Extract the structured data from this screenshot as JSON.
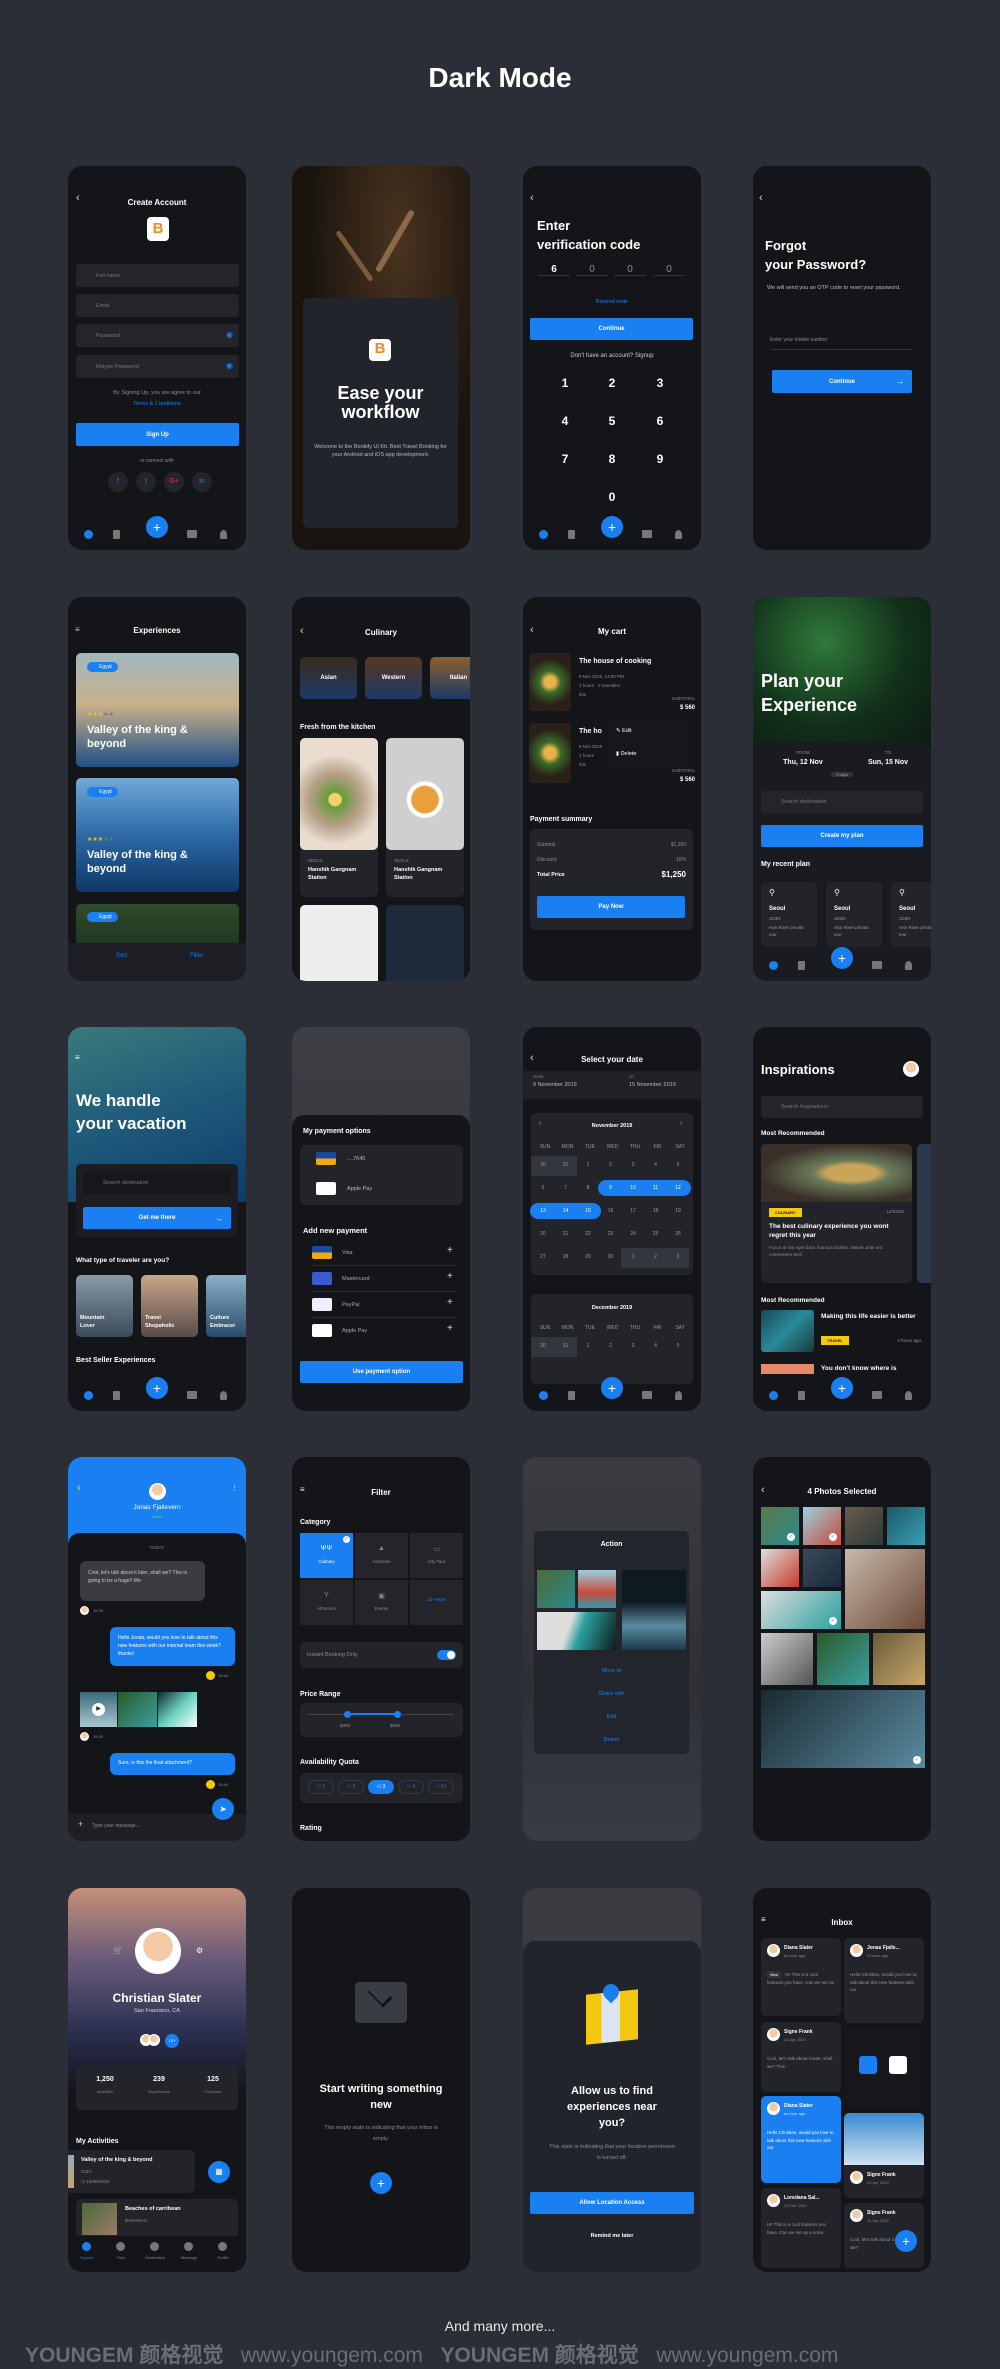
{
  "page": {
    "title": "Dark Mode",
    "footer": "And many more...",
    "watermark": [
      "YOUNGEM 颜格视觉",
      "www.youngem.com",
      "YOUNGEM 颜格视觉",
      "www.youngem.com"
    ]
  },
  "colors": {
    "accent": "#1a7ff0",
    "background": "#2b2e36",
    "phone": "#141518",
    "card": "#22242a",
    "logo": "#f08a24",
    "tag": "#f2c811"
  },
  "brand": {
    "logo_letter": "B"
  },
  "create_account": {
    "title": "Create Account",
    "fields": [
      "Full name",
      "Email",
      "Password",
      "Retype Password"
    ],
    "agree": "By Signing Up, you are agree to our",
    "terms": "Terms & Conditions",
    "signup": "Sign Up",
    "connect": "or connect with",
    "socials": [
      "f",
      "t",
      "G+",
      "in"
    ]
  },
  "onboarding": {
    "title": "Ease your workflow",
    "body": "Welcome to the Bookify UI Kit. Best Travel Booking for your Andriod and iOS app development."
  },
  "verify": {
    "title1": "Enter",
    "title2": "verification code",
    "digits": [
      "6",
      "0",
      "0",
      "0"
    ],
    "resend": "Resend code",
    "continue": "Continue",
    "signup": "Don't have an account? Signup",
    "keys": [
      "1",
      "2",
      "3",
      "4",
      "5",
      "6",
      "7",
      "8",
      "9",
      "0"
    ]
  },
  "forgot": {
    "title1": "Forgot",
    "title2": "your Password?",
    "body": "We will send you an OTP code to reset your password.",
    "placeholder": "Enter your mobile number",
    "continue": "Continue"
  },
  "experiences": {
    "title": "Experiences",
    "cards": [
      {
        "tag": "Egypt",
        "title": "Valley of the king & beyond",
        "rating": 3
      },
      {
        "tag": "Egypt",
        "title": "Valley of the king & beyond",
        "rating": 3
      },
      {
        "tag": "Egypt"
      }
    ],
    "sort": "Sort",
    "filter": "Filter"
  },
  "culinary": {
    "title": "Culinary",
    "categories": [
      "Asian",
      "Western",
      "Italian"
    ],
    "section": "Fresh from the kitchen",
    "items": [
      {
        "city": "SEOUL",
        "name": "Hanshik Gangnam Station"
      },
      {
        "city": "SEOUL",
        "name": "Hanshik Gangnam Station"
      }
    ]
  },
  "cart": {
    "title": "My cart",
    "items": [
      {
        "name": "The house of cooking",
        "date": "9 Nov 2019, 13:00 PM",
        "meta": "1 hours · 2 travellers",
        "place": "Ibis",
        "subtotal_label": "SUBTOTAL",
        "subtotal": "$ 560"
      },
      {
        "name": "The ho",
        "date": "9 Nov 2019",
        "meta": "1 hours",
        "place": "Ibis",
        "subtotal_label": "SUBTOTAL",
        "subtotal": "$ 560"
      }
    ],
    "menu": [
      "Edit",
      "Delete"
    ],
    "summary_title": "Payment summary",
    "subtotal_label": "Subtotal",
    "subtotal": "$1,350",
    "discount_label": "Discount",
    "discount": "10%",
    "total_label": "Total Price",
    "total": "$1,250",
    "pay": "Pay Now"
  },
  "plan": {
    "title1": "Plan your",
    "title2": "Experience",
    "from_label": "FROM",
    "from": "Thu, 12 Nov",
    "to_label": "TO",
    "to": "Sun, 15 Nov",
    "days": "3 days",
    "search": "Search destination",
    "create": "Create my plan",
    "recent": "My recent plan",
    "plans": [
      {
        "city": "Seoul",
        "dur": "2D3N",
        "desc": "Han River private tour"
      },
      {
        "city": "Seoul",
        "dur": "2D3N",
        "desc": "Han River private tour"
      },
      {
        "city": "Seoul",
        "dur": "2D3N",
        "desc": "Han River private tour"
      }
    ]
  },
  "vacation": {
    "title1": "We handle",
    "title2": "your vacation",
    "search": "Search destination",
    "go": "Get me there",
    "question": "What type of traveler are you?",
    "types": [
      {
        "l1": "Mountain",
        "l2": "Lover"
      },
      {
        "l1": "Travel",
        "l2": "Shopaholic"
      },
      {
        "l1": "Culture",
        "l2": "Embracer"
      }
    ],
    "best": "Best Seller Experiences"
  },
  "payment": {
    "title": "My payment options",
    "saved": [
      {
        "brand": "VISA",
        "label": "....7645"
      },
      {
        "brand": "Apple",
        "label": "Apple Pay"
      }
    ],
    "add_title": "Add new payment",
    "options": [
      {
        "brand": "VISA",
        "label": "Visa"
      },
      {
        "brand": "MC",
        "label": "Mastercard"
      },
      {
        "brand": "PayPal",
        "label": "PayPal"
      },
      {
        "brand": "Apple",
        "label": "Apple Pay"
      }
    ],
    "use": "Use payment option"
  },
  "dates": {
    "title": "Select your date",
    "from_label": "FROM",
    "from": "9 November 2019",
    "to_label": "TO",
    "to": "15 November 2019",
    "weekdays": [
      "SUN",
      "MON",
      "TUE",
      "WED",
      "THU",
      "FRI",
      "SAT"
    ],
    "nov": {
      "title": "November 2019",
      "days": [
        "30",
        "31",
        "1",
        "2",
        "3",
        "4",
        "5",
        "6",
        "7",
        "8",
        "9",
        "10",
        "11",
        "12",
        "13",
        "14",
        "15",
        "16",
        "17",
        "18",
        "19",
        "20",
        "21",
        "22",
        "23",
        "24",
        "25",
        "26",
        "27",
        "28",
        "29",
        "30",
        "1",
        "2",
        "3"
      ],
      "selected_from": 9,
      "selected_to": 15
    },
    "dec": {
      "title": "December 2019",
      "days": [
        "30",
        "31",
        "1",
        "2",
        "3",
        "4",
        "5"
      ]
    }
  },
  "inspirations": {
    "title": "Inspirations",
    "search": "Search Inspirations",
    "section1": "Most Recommended",
    "card": {
      "tag": "CULINARY",
      "date": "12/02/20",
      "title": "The best culinary experience you wont regret this year",
      "desc": "Fusce at nisi eget dolor rhoncus facilisis. Mauris ante nisi consectetur tech"
    },
    "section2": "Most Recommended",
    "item": {
      "title": "Making this life easier is better",
      "tag": "TRAVEL",
      "time": "3 hours ago"
    },
    "next": "You don't know where is"
  },
  "chat": {
    "name": "Jonas Fjallevern",
    "status": "online",
    "day": "TODAY",
    "messages": [
      {
        "text": "Cool, let's talk about it later, shall we? This is going to be a huge!! We",
        "time": "15:30"
      },
      {
        "text": "Hello Jonas, would you love to talk about this new features with our internal team this week? thanks!",
        "time": "15:44"
      },
      {
        "time": "15:30"
      },
      {
        "text": "Sure, is this the final attachment?",
        "time": "15:44"
      }
    ],
    "placeholder": "Type your message..."
  },
  "filter": {
    "title": "Filter",
    "category": "Category",
    "cats": [
      "Culinary",
      "Activities",
      "City Tour",
      "Attraction",
      "Events",
      "23+ More"
    ],
    "instant": "Instant Booking Only",
    "instant_on": true,
    "price": "Price Range",
    "price_min": "$300",
    "price_max": "$800",
    "quota": "Availability Quota",
    "quotas": [
      "1",
      "2",
      "3",
      "4",
      "5+"
    ],
    "quota_selected": 3,
    "rating": "Rating"
  },
  "action": {
    "title": "Action",
    "options": [
      "Move to",
      "Share with",
      "Edit",
      "Delete"
    ]
  },
  "photos": {
    "title": "4 Photos Selected"
  },
  "profile": {
    "name": "Christian Slater",
    "location": "San Francisco, CA",
    "friends_more": "12+",
    "stats": [
      {
        "value": "1,250",
        "label": "Activities"
      },
      {
        "value": "239",
        "label": "Experiences"
      },
      {
        "value": "125",
        "label": "Followers"
      }
    ],
    "section": "My Activities",
    "activities": [
      {
        "title": "Valley of the king & beyond",
        "place": "GIZA",
        "date": "10/08/2019"
      },
      {
        "title": "Beaches of carribean",
        "place": "BAHAMAS"
      }
    ],
    "nav": [
      "Explore",
      "Trips",
      "Destination",
      "Message",
      "Profile"
    ]
  },
  "empty": {
    "title": "Start writing something new",
    "body": "This empty state is indicating that your inbox is empty."
  },
  "location": {
    "title": "Allow us to find experiences near you?",
    "body": "This state is indicating that your location permission is turned off.",
    "allow": "Allow Location Access",
    "later": "Remind me later"
  },
  "inbox": {
    "title": "Inbox",
    "new": "New",
    "cards": [
      {
        "name": "Diana Slater",
        "time": "an hour ago",
        "text": "Hi! This is a cool features you have. Can we set up"
      },
      {
        "name": "Jonas Fjalle...",
        "time": "3 hours ago",
        "text": "Hello Christian, would you love to talk about this new features with our"
      },
      {
        "name": "Signe Frank",
        "time": "23 Apr 2020",
        "text": "Cool, let's talk about it later, shall we? This"
      },
      {
        "name": "Diana Slater",
        "time": "an hour ago",
        "text": "Hello Christian, would you love to talk about this new features with our"
      },
      {
        "name": "Signe Frank",
        "time": "23 Apr 2020"
      },
      {
        "name": "Loredana Sal...",
        "time": "12 Feb 2020",
        "text": "Hi! This is a cool features you have. Can we set up a voice"
      },
      {
        "name": "Signe Frank",
        "time": "11 Jan 2020",
        "text": "Cool, let's talk about it later, shall we?"
      }
    ]
  }
}
